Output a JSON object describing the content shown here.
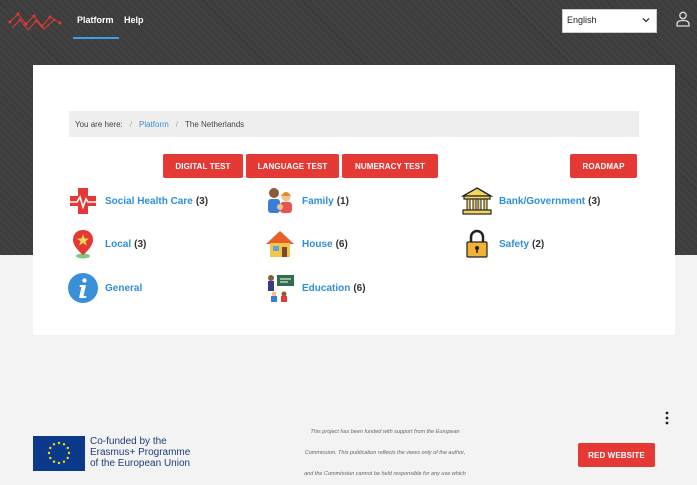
{
  "nav": {
    "links": [
      "Platform",
      "Help"
    ],
    "language": "English"
  },
  "breadcrumb": {
    "prefix": "You are here:",
    "items": [
      "Platform",
      "The Netherlands"
    ]
  },
  "tests": {
    "digital": "DIGITAL TEST",
    "language": "LANGUAGE TEST",
    "numeracy": "NUMERACY TEST",
    "roadmap": "ROADMAP"
  },
  "categories": [
    {
      "label": "Social Health Care",
      "count": "(3)",
      "icon": "medical-cross-icon"
    },
    {
      "label": "Family",
      "count": "(1)",
      "icon": "family-icon"
    },
    {
      "label": "Bank/Government",
      "count": "(3)",
      "icon": "bank-building-icon"
    },
    {
      "label": "Local",
      "count": "(3)",
      "icon": "map-pin-icon"
    },
    {
      "label": "House",
      "count": "(6)",
      "icon": "house-icon"
    },
    {
      "label": "Safety",
      "count": "(2)",
      "icon": "padlock-icon"
    },
    {
      "label": "General",
      "count": "",
      "icon": "info-icon"
    },
    {
      "label": "Education",
      "count": "(6)",
      "icon": "classroom-icon"
    }
  ],
  "footer": {
    "eu_lines": [
      "Co-funded by the",
      "Erasmus+ Programme",
      "of the European Union"
    ],
    "disclaimer_lines": [
      "This project has been funded with support from the European",
      "Commission. This publication reflects the views only of the author,",
      "and the Commission cannot be held responsible for any use which"
    ],
    "red_website": "RED WEBSITE"
  },
  "colors": {
    "accent_red": "#e53935",
    "link_blue": "#2f8fd8",
    "nav_underline": "#3aa1e4",
    "header_dark": "#3d3d3d"
  }
}
